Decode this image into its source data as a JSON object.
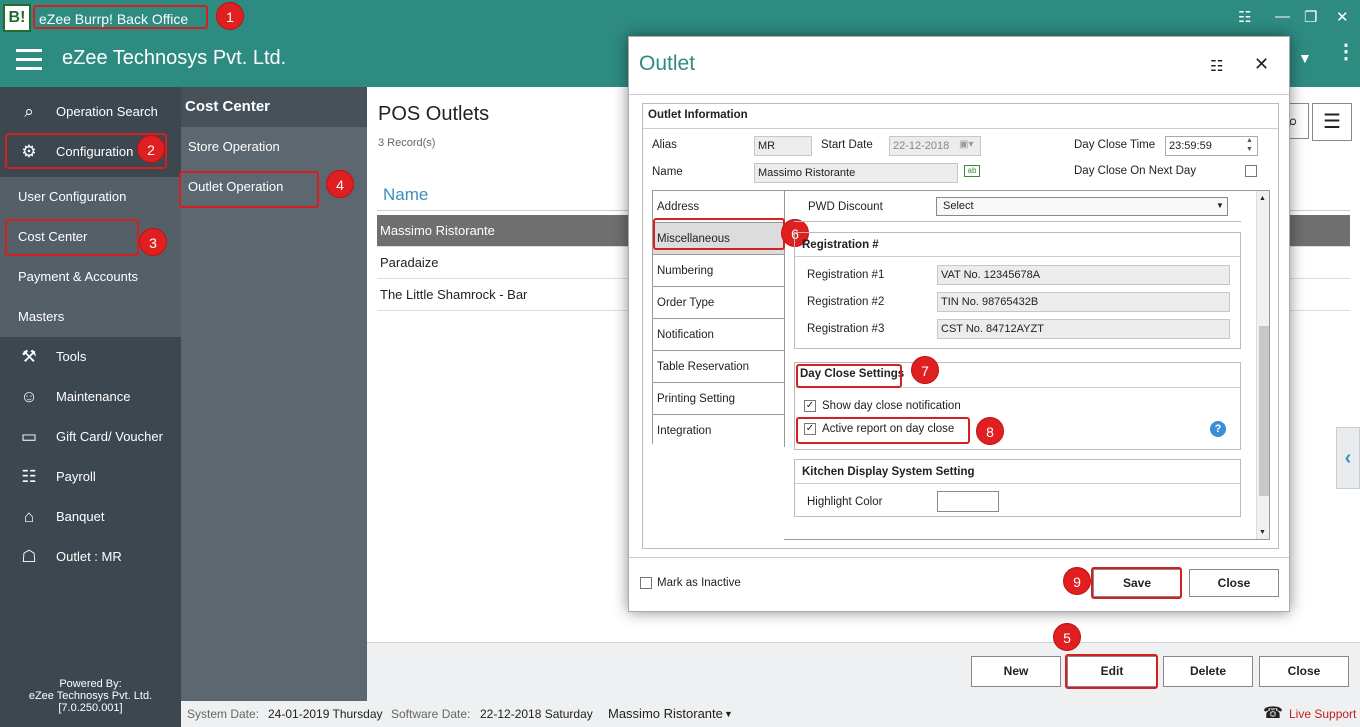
{
  "window": {
    "logo_text": "B!",
    "title": "eZee Burrp! Back Office"
  },
  "header": {
    "company": "eZee Technosys Pvt. Ltd."
  },
  "sidebar": {
    "items": [
      {
        "label": "Operation Search",
        "icon": "search-icon"
      },
      {
        "label": "Configuration",
        "icon": "gear-icon"
      },
      {
        "label": "Tools",
        "icon": "tools-icon"
      },
      {
        "label": "Maintenance",
        "icon": "maintenance-icon"
      },
      {
        "label": "Gift Card/ Voucher",
        "icon": "gift-card-icon"
      },
      {
        "label": "Payroll",
        "icon": "payroll-icon"
      },
      {
        "label": "Banquet",
        "icon": "banquet-icon"
      },
      {
        "label": "Outlet : MR",
        "icon": "outlet-icon"
      }
    ],
    "sub_items": [
      "User Configuration",
      "Cost Center",
      "Payment & Accounts",
      "Masters"
    ],
    "powered_by": [
      "Powered By:",
      "eZee Technosys Pvt. Ltd.",
      "[7.0.250.001]"
    ]
  },
  "cost_center_panel": {
    "title": "Cost Center",
    "items": [
      "Store Operation",
      "Outlet Operation"
    ]
  },
  "main": {
    "title": "POS Outlets",
    "records": "3 Record(s)",
    "column": "Name",
    "rows": [
      "Massimo Ristorante",
      "Paradaize",
      "The Little Shamrock - Bar"
    ],
    "buttons": {
      "new": "New",
      "edit": "Edit",
      "delete": "Delete",
      "close": "Close"
    }
  },
  "status_bar": {
    "system_date_label": "System Date:",
    "system_date": "24-01-2019 Thursday",
    "software_date_label": "Software Date:",
    "software_date": "22-12-2018 Saturday",
    "outlet": "Massimo Ristorante",
    "live_support": "Live Support"
  },
  "dialog": {
    "title": "Outlet",
    "section": "Outlet Information",
    "alias_label": "Alias",
    "alias": "MR",
    "start_date_label": "Start Date",
    "start_date": "22-12-2018",
    "day_close_time_label": "Day Close Time",
    "day_close_time": "23:59:59",
    "name_label": "Name",
    "name": "Massimo Ristorante",
    "day_close_next_day_label": "Day Close On Next Day",
    "tabs": [
      "Address",
      "Miscellaneous",
      "Numbering",
      "Order Type",
      "Notification",
      "Table Reservation",
      "Printing Setting",
      "Integration"
    ],
    "pwd_discount_label": "PWD Discount",
    "pwd_discount": "Select",
    "registration": {
      "title": "Registration #",
      "items": [
        {
          "label": "Registration #1",
          "value": "VAT No. 12345678A"
        },
        {
          "label": "Registration #2",
          "value": "TIN No. 98765432B"
        },
        {
          "label": "Registration #3",
          "value": "CST No. 84712AYZT"
        }
      ]
    },
    "day_close": {
      "title": "Day Close Settings",
      "show_notification": "Show day close notification",
      "active_report": "Active report on day close"
    },
    "kds": {
      "title": "Kitchen Display System Setting",
      "highlight_color_label": "Highlight Color"
    },
    "mark_inactive": "Mark as Inactive",
    "save": "Save",
    "close": "Close"
  },
  "markers": [
    "1",
    "2",
    "3",
    "4",
    "5",
    "6",
    "7",
    "8",
    "9"
  ],
  "colors": {
    "teal": "#2e8b82",
    "sidebar": "#3d4750",
    "marker": "#e02020"
  }
}
